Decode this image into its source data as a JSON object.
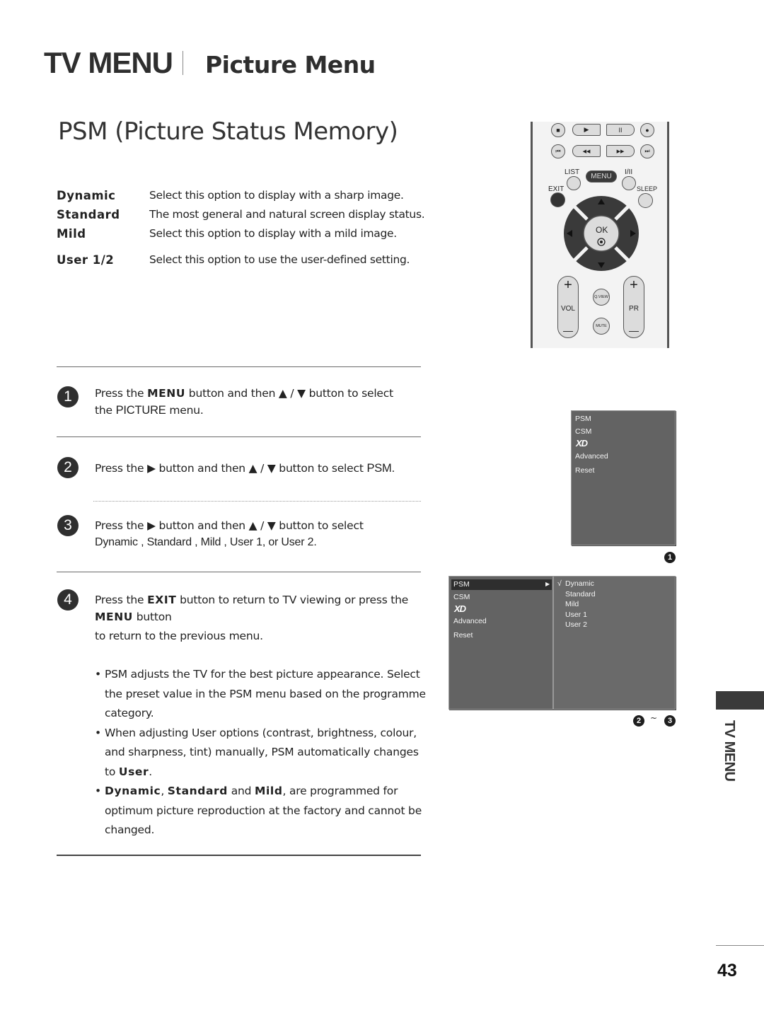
{
  "header": {
    "section": "TV MENU",
    "subsection": "Picture Menu"
  },
  "title": "PSM (Picture Status Memory)",
  "options": [
    {
      "name": "Dynamic",
      "desc": "Select this option to display with a sharp image."
    },
    {
      "name": "Standard",
      "desc": "The most general and natural screen display status."
    },
    {
      "name": "Mild",
      "desc": "Select this option to display with a mild image."
    },
    {
      "name": "User 1/2",
      "desc": "Select this option to use the user-defined setting."
    }
  ],
  "steps": [
    {
      "num": "1",
      "line1": {
        "a": "Press the ",
        "b": "MENU",
        "c": " button and then ▲ / ▼ button to select"
      },
      "line2": {
        "a": "the ",
        "b": "PICTURE",
        "c": " menu."
      }
    },
    {
      "num": "2",
      "line1": {
        "a": "Press the ▶ button and then ▲ / ▼ button to select ",
        "b": "PSM."
      }
    },
    {
      "num": "3",
      "line1": {
        "a": "Press the ▶ button and then ▲ / ▼ button to select"
      },
      "line2": {
        "a": "Dynamic  , Standard  , Mild , User 1, or User 2."
      }
    },
    {
      "num": "4",
      "line1": {
        "a": "Press the ",
        "b": "EXIT",
        "c": " button to return to TV viewing or press the"
      },
      "line2": {
        "b": "MENU",
        "c": " button"
      },
      "line3": {
        "a": "to return to the previous menu."
      }
    }
  ],
  "notes": [
    {
      "text": "PSM adjusts the TV for the best picture appearance. Select  the preset value in the  PSM menu based on the programme  category."
    },
    {
      "a": "When adjusting User options (contrast, brightness, colour, and  sharpness, tint) manually, PSM  automatically changes to ",
      "b": "User",
      "c": "."
    },
    {
      "b1": "Dynamic",
      "s1": ", ",
      "b2": "Standard",
      "s2": " and  ",
      "b3": "Mild",
      "rest": ", are programmed for optimum picture reproduction  at the factory and cannot be changed."
    }
  ],
  "remote": {
    "transport_row1": [
      "■",
      "▶",
      "II",
      "●"
    ],
    "transport_row2": [
      "⏮",
      "◀◀",
      "▶▶",
      "⏭"
    ],
    "list": "LIST",
    "menu": "MENU",
    "i_ii": "I/II",
    "exit": "EXIT",
    "sleep": "SLEEP",
    "ok": "OK",
    "vol": "VOL",
    "pr": "PR",
    "qview": "Q.VIEW",
    "mute": "MUTE",
    "plus": "+",
    "minus": "—"
  },
  "osd1": {
    "items": [
      "PSM",
      "CSM",
      "XD",
      "Advanced",
      "Reset"
    ],
    "step_badge": "1"
  },
  "osd2": {
    "left_items": [
      "PSM",
      "CSM",
      "XD",
      "Advanced",
      "Reset"
    ],
    "selected": "PSM",
    "arrow": "▶",
    "right_items": [
      "Dynamic",
      "Standard",
      "Mild",
      "User 1",
      "User 2"
    ],
    "checked": "√",
    "step_badge_from": "2",
    "tilde": "~",
    "step_badge_to": "3"
  },
  "side_tab": "TV MENU",
  "page_number": "43"
}
